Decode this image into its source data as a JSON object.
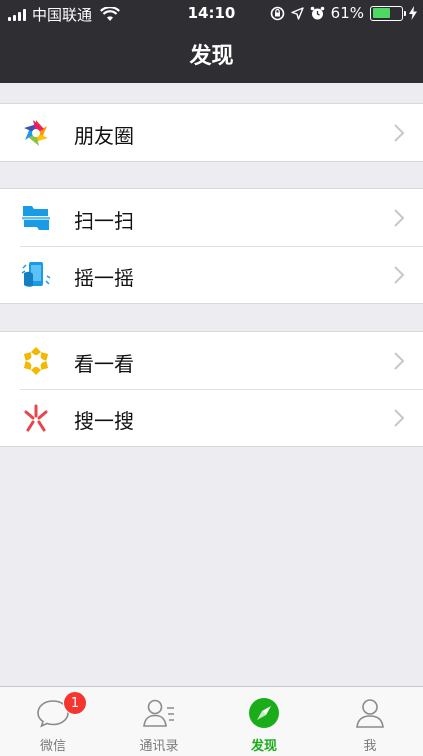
{
  "status_bar": {
    "carrier": "中国联通",
    "time": "14:10",
    "battery_text": "61%",
    "battery_level": 0.61,
    "icons": [
      "signal-icon",
      "wifi-icon",
      "orientation-lock-icon",
      "location-icon",
      "alarm-icon",
      "battery-icon",
      "charging-icon"
    ]
  },
  "nav": {
    "title": "发现"
  },
  "groups": [
    {
      "items": [
        {
          "label": "朋友圈",
          "icon": "moments-icon"
        }
      ]
    },
    {
      "items": [
        {
          "label": "扫一扫",
          "icon": "scan-icon"
        },
        {
          "label": "摇一摇",
          "icon": "shake-icon"
        }
      ]
    },
    {
      "items": [
        {
          "label": "看一看",
          "icon": "top-stories-icon"
        },
        {
          "label": "搜一搜",
          "icon": "search-icon"
        }
      ]
    }
  ],
  "tabs": [
    {
      "label": "微信",
      "icon": "chats-icon",
      "badge": "1"
    },
    {
      "label": "通讯录",
      "icon": "contacts-icon"
    },
    {
      "label": "发现",
      "icon": "discover-icon",
      "active": true
    },
    {
      "label": "我",
      "icon": "me-icon"
    }
  ],
  "colors": {
    "active_tab": "#1aad19",
    "nav_bg": "#2e2e33",
    "badge": "#f43530",
    "battery": "#4cd964"
  }
}
